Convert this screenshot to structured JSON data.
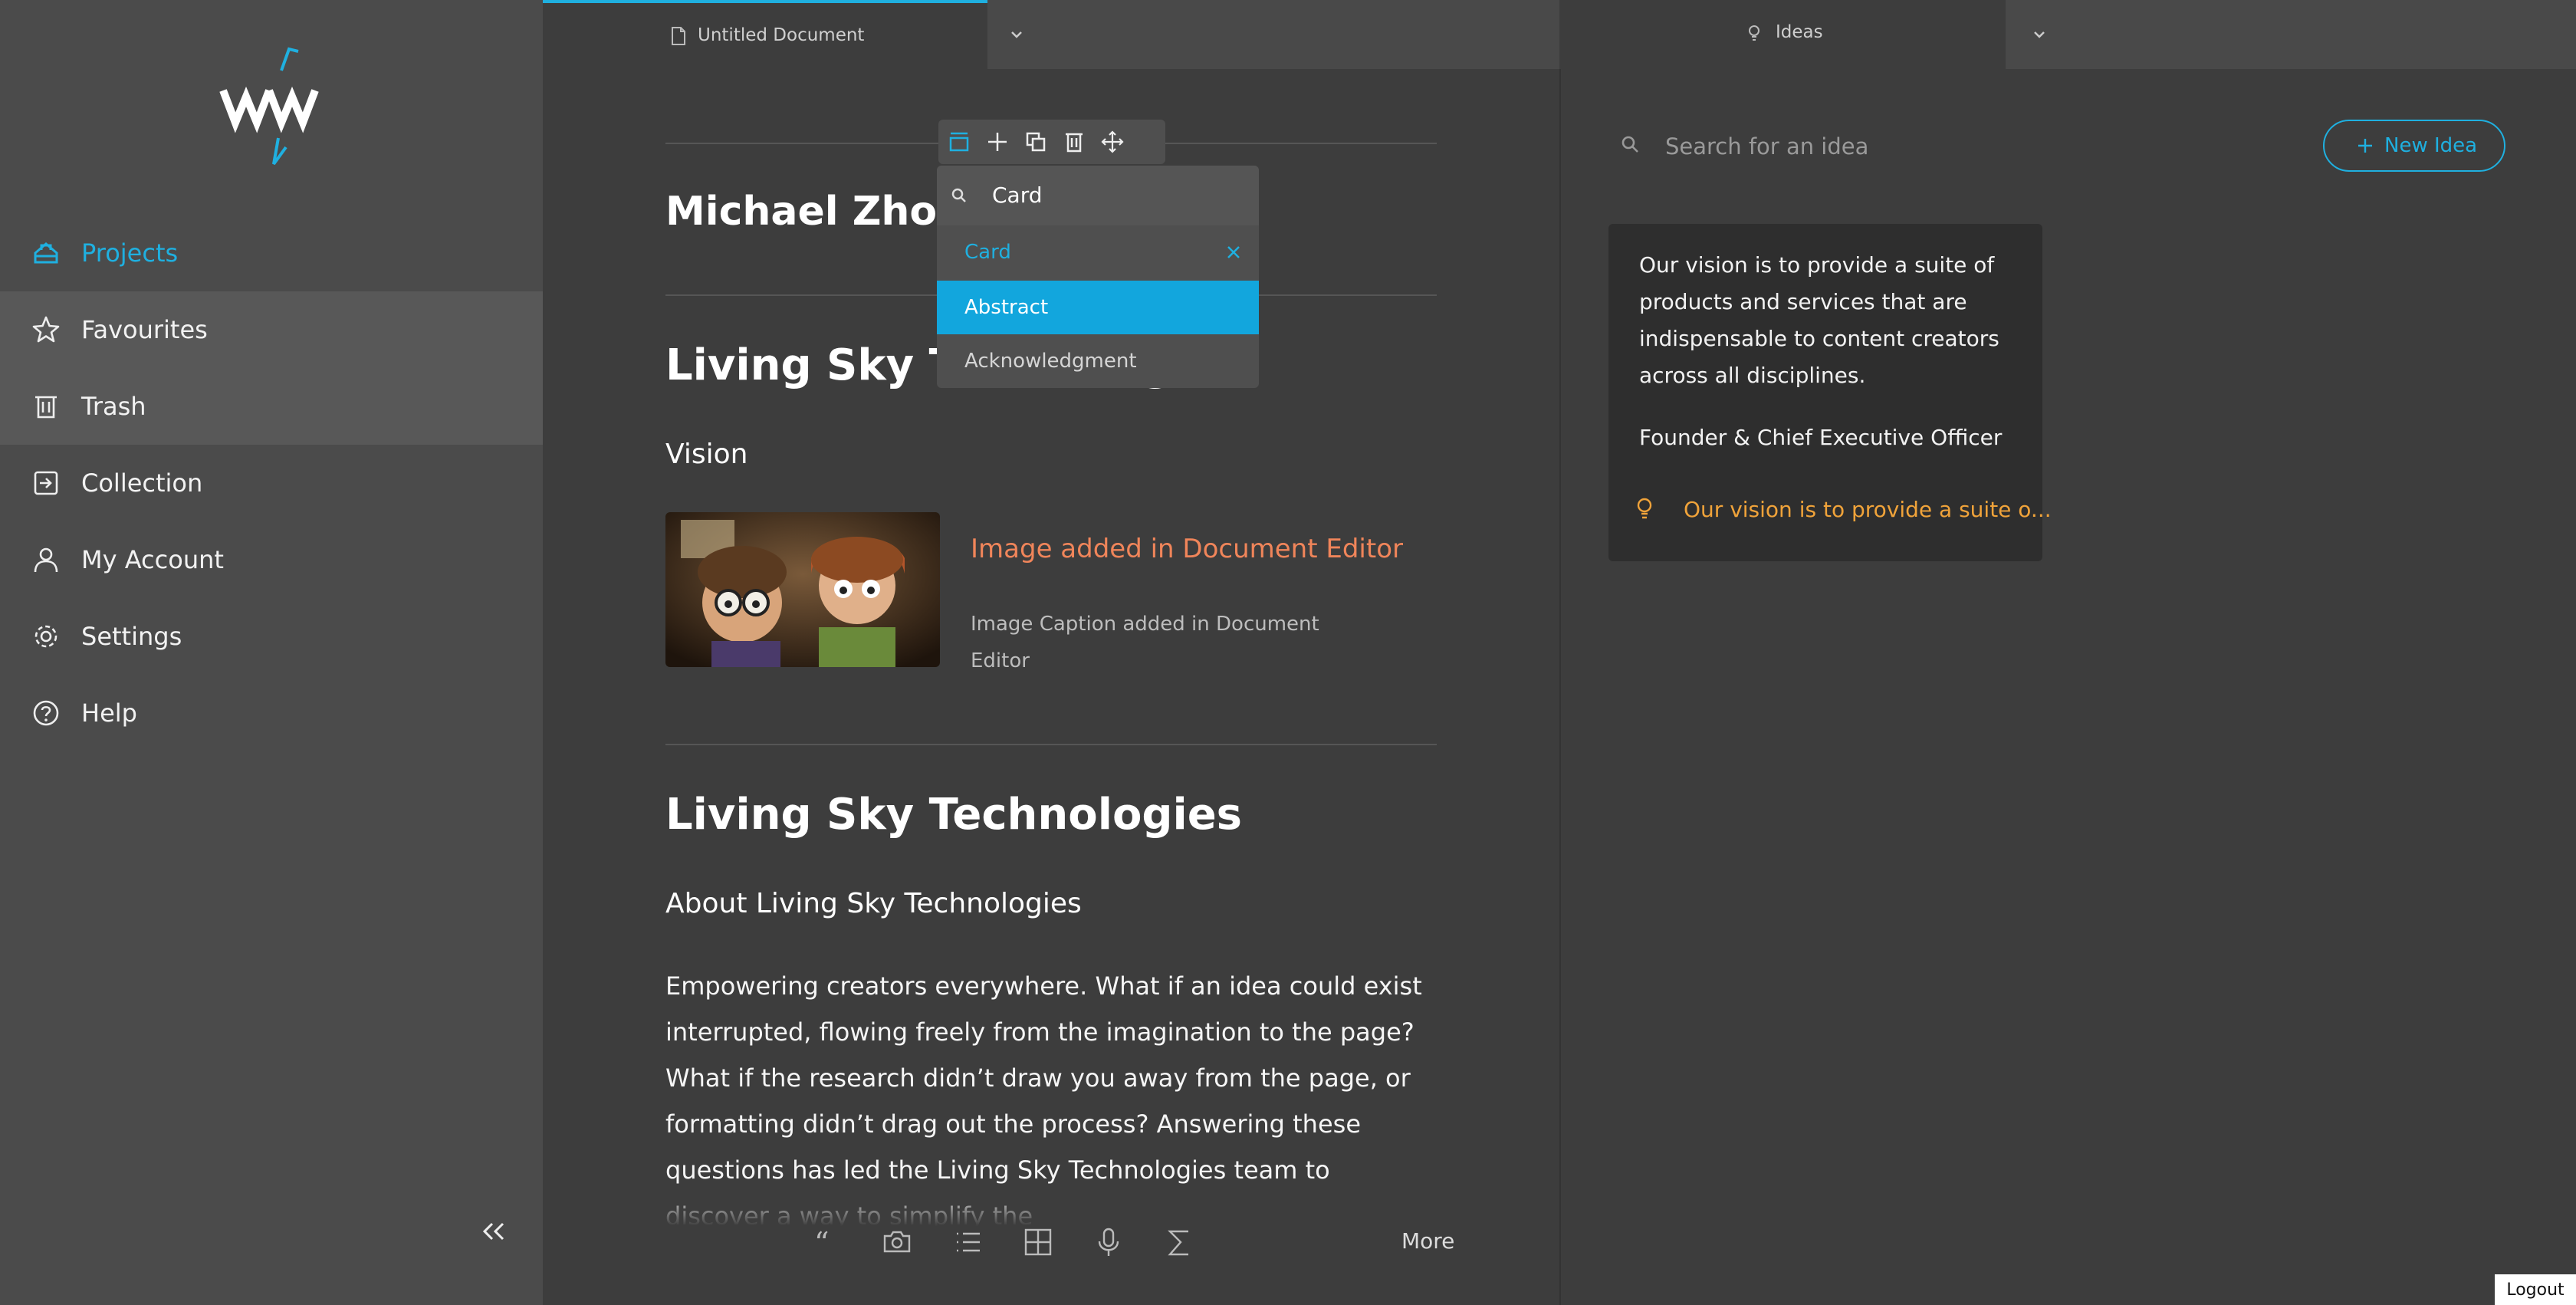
{
  "colors": {
    "accent": "#1fb0e0",
    "orange": "#f0855a",
    "gold": "#f0a33a"
  },
  "sidebar": {
    "items": [
      {
        "label": "Projects",
        "icon": "projects-icon",
        "active": true
      },
      {
        "label": "Favourites",
        "icon": "star-icon"
      },
      {
        "label": "Trash",
        "icon": "trash-icon"
      },
      {
        "label": "Collection",
        "icon": "collection-icon"
      },
      {
        "label": "My Account",
        "icon": "user-icon"
      },
      {
        "label": "Settings",
        "icon": "gear-icon"
      },
      {
        "label": "Help",
        "icon": "help-icon"
      }
    ],
    "collapse_icon": "double-chevron-left-icon"
  },
  "document": {
    "tab_label": "Untitled Document",
    "author": "Michael Zhou",
    "section1_title": "Living Sky Technologies",
    "section1_sub": "Vision",
    "image_title": "Image added in Document Editor",
    "image_caption": "Image Caption added in Document Editor",
    "section2_title": "Living Sky Technologies",
    "section2_sub": "About Living Sky Technologies",
    "paragraph": "Empowering creators everywhere. What if an idea could exist interrupted, flowing freely from the imagination to the page? What if the research didn’t draw you away from the page, or formatting didn’t drag out the process? Answering these questions has led the Living Sky Technologies team to discover a way to simplify the"
  },
  "block_menu": {
    "search_value": "Card",
    "items": [
      {
        "label": "Card",
        "state": "selected"
      },
      {
        "label": "Abstract",
        "state": "highlighted"
      },
      {
        "label": "Acknowledgment",
        "state": "normal"
      }
    ]
  },
  "bottom_toolbar": {
    "tools": [
      "quote-icon",
      "camera-icon",
      "list-icon",
      "table-icon",
      "microphone-icon",
      "sigma-icon"
    ],
    "more_label": "More"
  },
  "ideas": {
    "tab_label": "Ideas",
    "search_placeholder": "Search for an idea",
    "new_button": "New Idea",
    "card": {
      "body": "Our vision is to provide a suite of products and services that are indispensable to content creators across all disciplines.",
      "role": "Founder & Chief Executive Officer",
      "link": "Our vision is to provide a suite o..."
    }
  },
  "logout_label": "Logout"
}
